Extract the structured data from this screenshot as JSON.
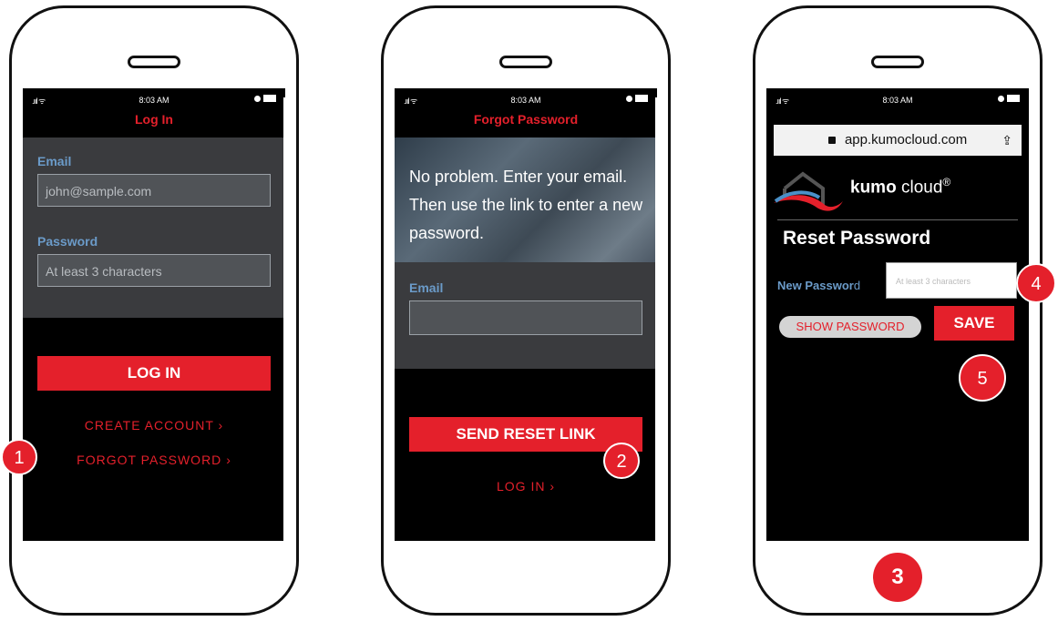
{
  "status": {
    "time": "8:03 AM"
  },
  "screen1": {
    "title": "Log In",
    "email_label": "Email",
    "email_placeholder": "john@sample.com",
    "password_label": "Password",
    "password_placeholder": "At least 3 characters",
    "login_button": "LOG IN",
    "create_account": "CREATE ACCOUNT",
    "forgot_password": "FORGOT PASSWORD"
  },
  "screen2": {
    "title": "Forgot Password",
    "message": "No problem. Enter your email. Then use the link to enter a new password.",
    "email_label": "Email",
    "send_button": "SEND RESET LINK",
    "login_link": "LOG IN"
  },
  "screen3": {
    "url": "app.kumocloud.com",
    "brand_bold": "kumo",
    "brand_rest": " cloud",
    "brand_reg": "®",
    "heading": "Reset Password",
    "new_password_label_a": "New Passwor",
    "new_password_label_b": "d",
    "new_password_placeholder": "At least 3 characters",
    "show_password": "SHOW PASSWORD",
    "save_button": "SAVE"
  },
  "badges": {
    "b1": "1",
    "b2": "2",
    "b3": "3",
    "b4": "4",
    "b5": "5"
  },
  "colors": {
    "accent": "#e4202b",
    "label_blue": "#6b9bc9",
    "panel": "#3a3b3e"
  }
}
